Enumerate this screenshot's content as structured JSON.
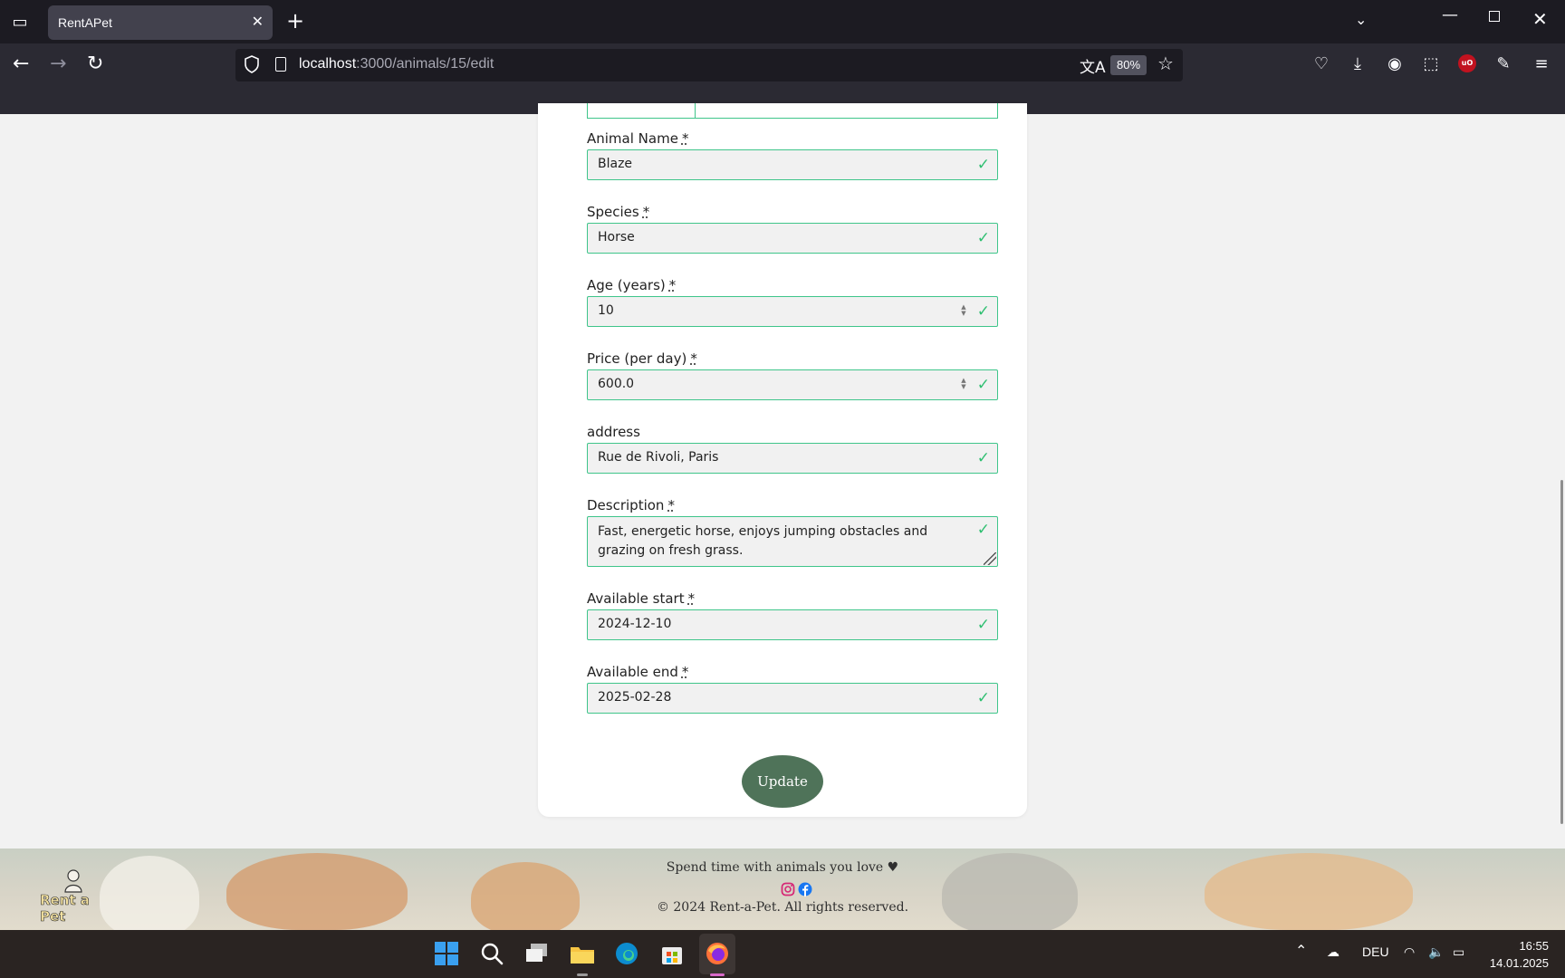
{
  "browser": {
    "tab_title": "RentAPet",
    "url_host": "localhost",
    "url_path": ":3000/animals/15/edit",
    "zoom": "80%"
  },
  "form": {
    "fields": [
      {
        "label": "Animal Name",
        "required": "*",
        "value": "Blaze"
      },
      {
        "label": "Species",
        "required": "*",
        "value": "Horse"
      },
      {
        "label": "Age (years)",
        "required": "*",
        "value": "10"
      },
      {
        "label": "Price (per day)",
        "required": "*",
        "value": "600.0"
      },
      {
        "label": "address",
        "required": "",
        "value": "Rue de Rivoli, Paris"
      },
      {
        "label": "Description",
        "required": "*",
        "value": "Fast, energetic horse, enjoys jumping obstacles and grazing on fresh grass."
      },
      {
        "label": "Available start",
        "required": "*",
        "value": "2024-12-10"
      },
      {
        "label": "Available end",
        "required": "*",
        "value": "2025-02-28"
      }
    ],
    "submit_label": "Update",
    "valid_color": "#2fbf71",
    "button_color": "#4f7359"
  },
  "footer": {
    "tagline": "Spend time with animals you love ♥",
    "copyright": "© 2024 Rent-a-Pet. All rights reserved.",
    "logo_text": "Rent a Pet",
    "social_icons": [
      "instagram-icon",
      "facebook-icon"
    ]
  },
  "taskbar": {
    "language": "DEU",
    "time": "16:55",
    "date": "14.01.2025"
  }
}
